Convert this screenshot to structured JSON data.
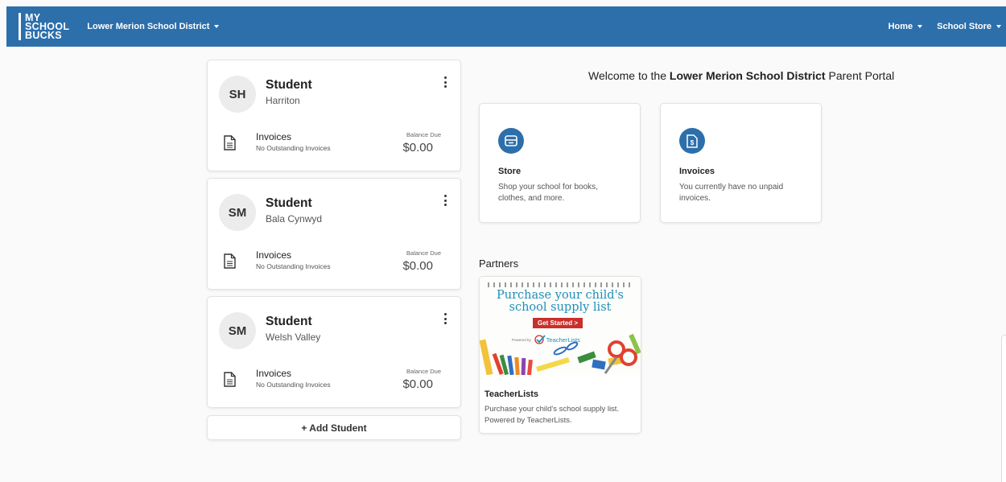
{
  "brand": {
    "line1": "MY",
    "line2": "SCHOOL",
    "line3": "BUCKS"
  },
  "header": {
    "district": "Lower Merion School District",
    "nav": [
      "Home",
      "School Store"
    ]
  },
  "students": [
    {
      "initials": "SH",
      "name": "Student",
      "school": "Harriton",
      "invoices_label": "Invoices",
      "invoices_status": "No Outstanding Invoices",
      "balance_label": "Balance Due",
      "balance": "$0.00"
    },
    {
      "initials": "SM",
      "name": "Student",
      "school": "Bala Cynwyd",
      "invoices_label": "Invoices",
      "invoices_status": "No Outstanding Invoices",
      "balance_label": "Balance Due",
      "balance": "$0.00"
    },
    {
      "initials": "SM",
      "name": "Student",
      "school": "Welsh Valley",
      "invoices_label": "Invoices",
      "invoices_status": "No Outstanding Invoices",
      "balance_label": "Balance Due",
      "balance": "$0.00"
    }
  ],
  "add_student": "+ Add Student",
  "welcome": {
    "prefix": "Welcome to the ",
    "district": "Lower Merion School District",
    "suffix": " Parent Portal"
  },
  "tiles": [
    {
      "icon": "store-icon",
      "title": "Store",
      "description": "Shop your school for books, clothes, and more."
    },
    {
      "icon": "invoice-icon",
      "title": "Invoices",
      "description": "You currently have no unpaid invoices."
    }
  ],
  "partners": {
    "heading": "Partners",
    "items": [
      {
        "banner_heading": "Purchase your child's school supply list",
        "banner_button": "Get Started >",
        "banner_powered": "Powered by",
        "banner_brand": "TeacherLists",
        "title": "TeacherLists",
        "description": "Purchase your child's school supply list. Powered by TeacherLists."
      }
    ]
  },
  "colors": {
    "primary": "#2c6fab",
    "banner_text": "#1d8fb8",
    "banner_button": "#c9302c"
  }
}
